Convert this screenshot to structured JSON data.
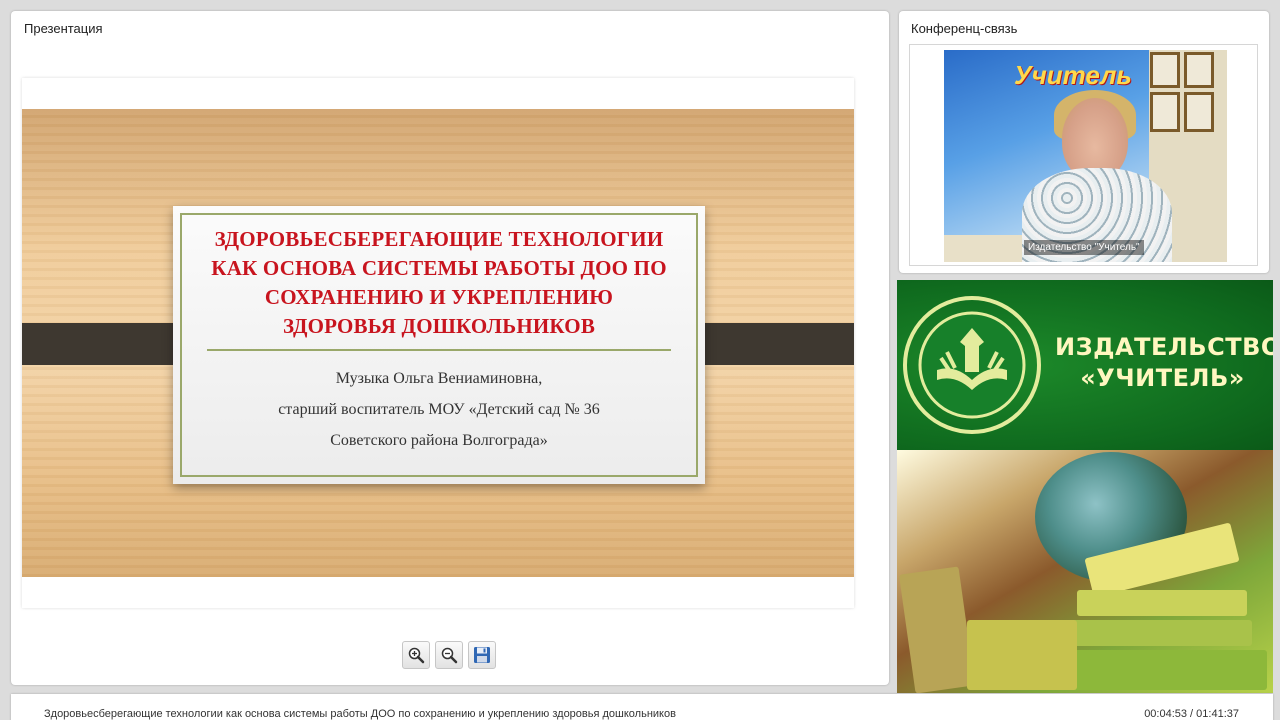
{
  "presentation": {
    "title": "Презентация",
    "slide": {
      "heading": "Здоровьесберегающие технологии\nкак основа системы работы ДОО по\nсохранению и укреплению\nздоровья  дошкольников",
      "author_name": "Музыка Ольга Вениаминовна,",
      "author_position": "старший воспитатель МОУ «Детский сад № 36",
      "author_district": "Советского района Волгограда»"
    },
    "toolbar": {
      "zoom_in_icon": "zoom-in-icon",
      "zoom_out_icon": "zoom-out-icon",
      "save_icon": "floppy-disk-icon"
    }
  },
  "conference": {
    "title": "Конференц-связь",
    "video_label": "Издательство \"Учитель\"",
    "banner_logo_text": "Учитель"
  },
  "publisher_banner": {
    "name": "ИЗДАТЕЛЬСТВО «УЧИТЕЛЬ»",
    "accent_color": "#0f6a1e",
    "text_color": "#fff7c0"
  },
  "status_bar": {
    "lecture_title": "Здоровьесберегающие технологии как основа системы работы ДОО по сохранению и укреплению здоровья дошкольников",
    "playback_time": "00:04:53 / 01:41:37"
  },
  "colors": {
    "heading_red": "#c8141e",
    "card_border": "#9aa86a",
    "band": "#3e3830"
  }
}
